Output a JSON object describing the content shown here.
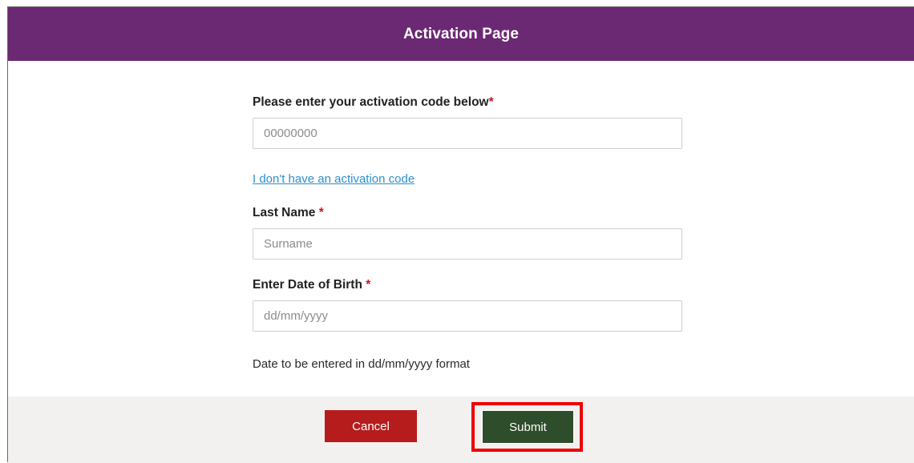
{
  "header": {
    "title": "Activation Page"
  },
  "form": {
    "activation_code": {
      "label": "Please enter your activation code below",
      "required_mark": "*",
      "placeholder": "00000000",
      "value": ""
    },
    "no_code_link": "I don't have an activation code",
    "last_name": {
      "label": "Last Name",
      "required_mark": "*",
      "placeholder": "Surname",
      "value": ""
    },
    "dob": {
      "label": "Enter Date of Birth",
      "required_mark": "*",
      "placeholder": "dd/mm/yyyy",
      "value": ""
    },
    "dob_hint": "Date to be entered in dd/mm/yyyy format"
  },
  "footer": {
    "cancel_label": "Cancel",
    "submit_label": "Submit"
  },
  "colors": {
    "header_bg": "#6b2873",
    "required": "#d0141c",
    "link": "#2e8fd1",
    "cancel_bg": "#b71c1c",
    "submit_bg": "#2e4d2a",
    "highlight": "#ef0000",
    "footer_bg": "#f3f1f0"
  }
}
